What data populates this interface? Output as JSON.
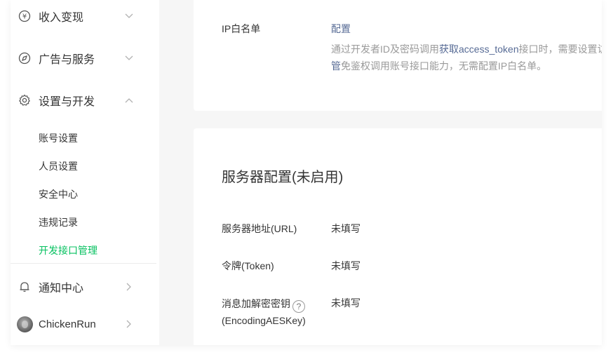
{
  "sidebar": {
    "groups": {
      "income": {
        "label": "收入变现",
        "icon": "yen-circle-icon",
        "expanded": false
      },
      "ads": {
        "label": "广告与服务",
        "icon": "compass-icon",
        "expanded": false
      },
      "settings": {
        "label": "设置与开发",
        "icon": "gear-icon",
        "expanded": true
      }
    },
    "sub_items": [
      {
        "label": "账号设置",
        "active": false
      },
      {
        "label": "人员设置",
        "active": false
      },
      {
        "label": "安全中心",
        "active": false
      },
      {
        "label": "违规记录",
        "active": false
      },
      {
        "label": "开发接口管理",
        "active": true
      }
    ],
    "notifications": {
      "label": "通知中心",
      "icon": "bell-icon"
    },
    "account": {
      "name": "ChickenRun",
      "icon": "avatar"
    }
  },
  "ip_whitelist": {
    "label": "IP白名单",
    "action": "配置",
    "desc_prefix": "通过开发者ID及密码调用",
    "desc_link": "获取access_token",
    "desc_mid": "接口时，需要设置访",
    "desc_link2": "管",
    "desc_suffix": "免鉴权调用账号接口能力，无需配置IP白名单。"
  },
  "server_config": {
    "title": "服务器配置(未启用)",
    "rows": [
      {
        "label": "服务器地址(URL)",
        "value": "未填写"
      },
      {
        "label": "令牌(Token)",
        "value": "未填写"
      },
      {
        "label": "消息加解密密钥",
        "label2": "(EncodingAESKey)",
        "value": "未填写"
      }
    ]
  },
  "colors": {
    "accent": "#07c160",
    "link": "#576b95",
    "muted": "#9a9a9a"
  }
}
